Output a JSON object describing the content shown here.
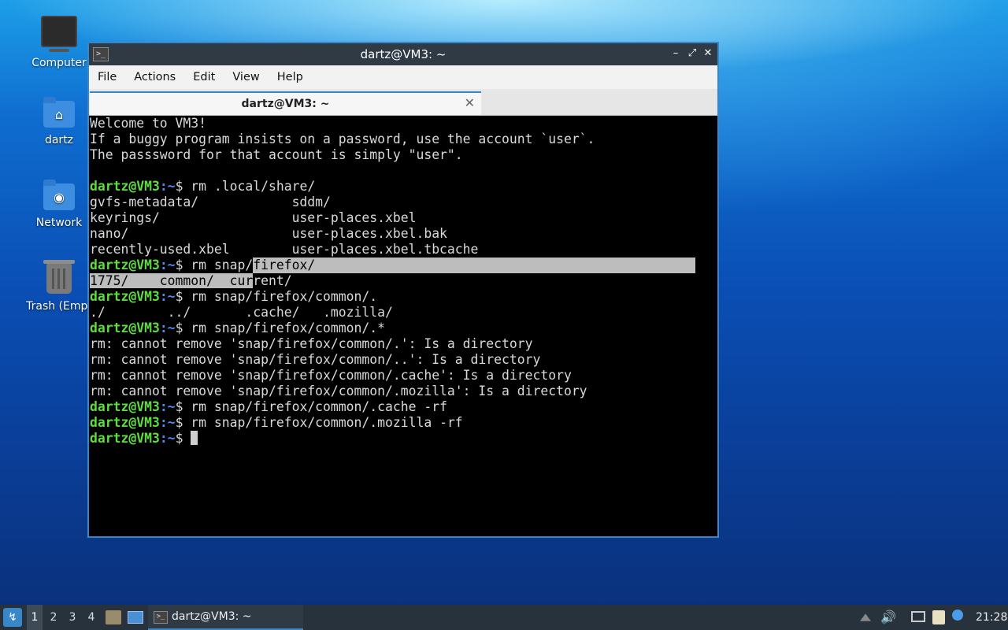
{
  "desktop": {
    "icons": [
      {
        "label": "Computer",
        "icon": "computer-icon"
      },
      {
        "label": "dartz",
        "icon": "home-folder-icon"
      },
      {
        "label": "Network",
        "icon": "network-folder-icon"
      },
      {
        "label": "Trash (Empt",
        "icon": "trash-icon"
      }
    ]
  },
  "window": {
    "title": "dartz@VM3: ~",
    "controls": {
      "minimize": "–",
      "maximize": "⤢",
      "close": "✕"
    },
    "menu": [
      "File",
      "Actions",
      "Edit",
      "View",
      "Help"
    ],
    "tab": {
      "title": "dartz@VM3: ~",
      "close": "✕"
    }
  },
  "terminal": {
    "prompt_user": "dartz@VM3",
    "prompt_path": ":~",
    "lines": [
      {
        "type": "text",
        "text": "Welcome to VM3!"
      },
      {
        "type": "text",
        "text": "If a buggy program insists on a password, use the account `user`."
      },
      {
        "type": "text",
        "text": "The passsword for that account is simply \"user\"."
      },
      {
        "type": "text",
        "text": ""
      },
      {
        "type": "cmd",
        "text": "$ rm .local/share/"
      },
      {
        "type": "text",
        "text": "gvfs-metadata/            sddm/"
      },
      {
        "type": "text",
        "text": "keyrings/                 user-places.xbel"
      },
      {
        "type": "text",
        "text": "nano/                     user-places.xbel.bak"
      },
      {
        "type": "text",
        "text": "recently-used.xbel        user-places.xbel.tbcache"
      },
      {
        "type": "cmd-sel",
        "before": "$ rm snap/",
        "selected": "firefox/",
        "after": ""
      },
      {
        "type": "text-sel",
        "selected": "1775/    common/  cur",
        "after": "rent/"
      },
      {
        "type": "cmd",
        "text": "$ rm snap/firefox/common/."
      },
      {
        "type": "text",
        "text": "./        ../       .cache/   .mozilla/"
      },
      {
        "type": "cmd",
        "text": "$ rm snap/firefox/common/.*"
      },
      {
        "type": "text",
        "text": "rm: cannot remove 'snap/firefox/common/.': Is a directory"
      },
      {
        "type": "text",
        "text": "rm: cannot remove 'snap/firefox/common/..': Is a directory"
      },
      {
        "type": "text",
        "text": "rm: cannot remove 'snap/firefox/common/.cache': Is a directory"
      },
      {
        "type": "text",
        "text": "rm: cannot remove 'snap/firefox/common/.mozilla': Is a directory"
      },
      {
        "type": "cmd",
        "text": "$ rm snap/firefox/common/.cache -rf"
      },
      {
        "type": "cmd",
        "text": "$ rm snap/firefox/common/.mozilla -rf"
      },
      {
        "type": "cmd-cursor",
        "text": "$ "
      }
    ]
  },
  "taskbar": {
    "workspaces": [
      "1",
      "2",
      "3",
      "4"
    ],
    "active_workspace": "1",
    "task_title": "dartz@VM3: ~",
    "clock": "21:28"
  },
  "colors": {
    "prompt_green": "#5fdc3e",
    "path_blue": "#4a8cf0",
    "window_border": "#3a87c8",
    "taskbar_bg": "#27323d"
  }
}
